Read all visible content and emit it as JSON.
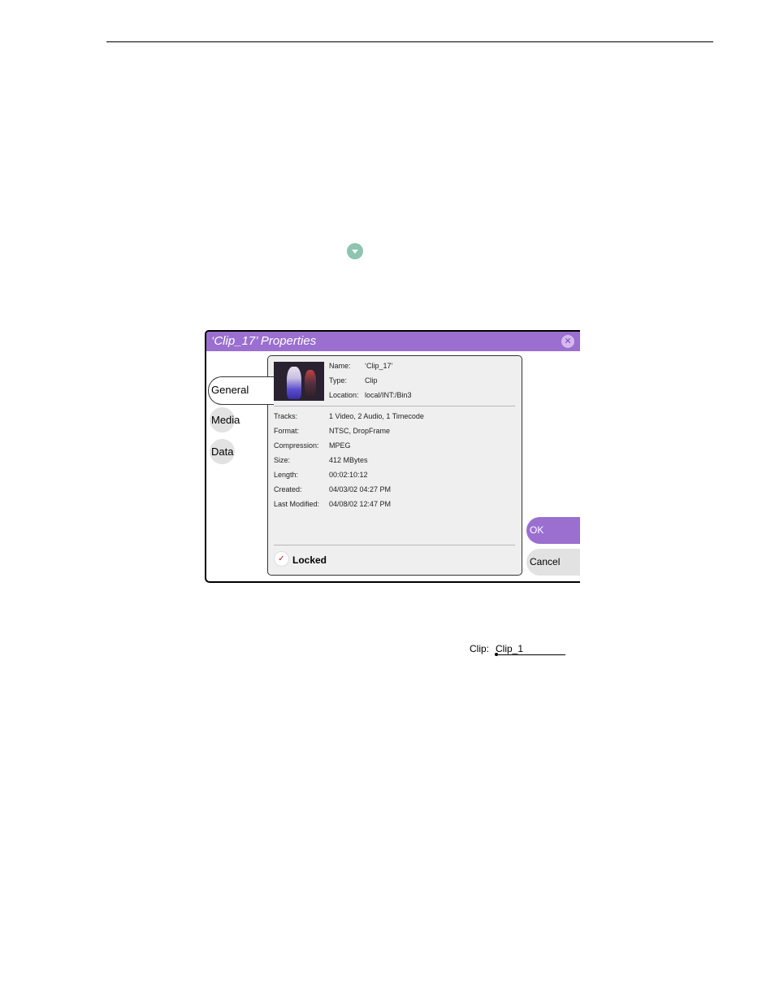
{
  "dialog": {
    "title": "‘Clip_17’ Properties",
    "close_icon": "close-icon",
    "tabs": [
      {
        "label": "General",
        "active": true
      },
      {
        "label": "Media",
        "active": false
      },
      {
        "label": "Data",
        "active": false
      }
    ],
    "header_fields": [
      {
        "label": "Name:",
        "value": "‘Clip_17’"
      },
      {
        "label": "Type:",
        "value": "Clip"
      },
      {
        "label": "Location:",
        "value": "local/INT:/Bin3"
      }
    ],
    "details": [
      {
        "label": "Tracks:",
        "value": "1 Video, 2 Audio, 1 Timecode"
      },
      {
        "label": "Format:",
        "value": "NTSC, DropFrame"
      },
      {
        "label": "Compression:",
        "value": "MPEG"
      },
      {
        "label": "Size:",
        "value": "412 MBytes"
      },
      {
        "label": "Length:",
        "value": "00:02:10:12"
      },
      {
        "label": "Created:",
        "value": "04/03/02 04:27 PM"
      },
      {
        "label": "Last Modified:",
        "value": "04/08/02 12:47 PM"
      }
    ],
    "locked": {
      "label": "Locked",
      "checked": true,
      "mark": "✓"
    },
    "ok_label": "OK",
    "cancel_label": "Cancel",
    "colors": {
      "accent": "#9a6fd0",
      "button_gray": "#e2e2e2"
    }
  },
  "clip_widget": {
    "label": "Clip:",
    "value": "Clip_1"
  },
  "page_icons": {
    "dropdown": "chevron-down-icon"
  }
}
